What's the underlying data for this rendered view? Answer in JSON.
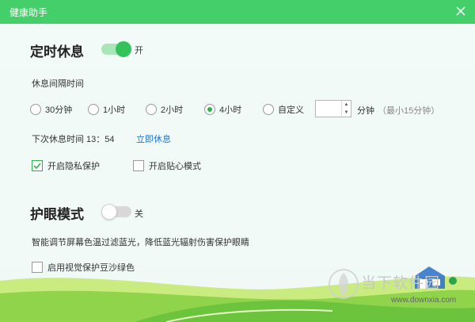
{
  "window": {
    "title": "健康助手"
  },
  "rest": {
    "title": "定时休息",
    "toggle_state": "开",
    "interval_label": "休息间隔时间",
    "options": [
      "30分钟",
      "1小时",
      "2小时",
      "4小时",
      "自定义"
    ],
    "selected_option": "4小时",
    "custom_value": "",
    "custom_unit": "分钟",
    "custom_hint": "（最小15分钟）",
    "next_rest_label": "下次休息时间 13：54",
    "rest_now_link": "立即休息",
    "privacy_label": "开启隐私保护",
    "privacy_checked": true,
    "caring_label": "开启贴心模式",
    "caring_checked": false
  },
  "eye": {
    "title": "护眼模式",
    "toggle_state": "关",
    "description": "智能调节屏幕色温过滤蓝光，降低蓝光辐射伤害保护眼睛",
    "bean_green_label": "启用视觉保护豆沙绿色",
    "bean_green_checked": false
  },
  "watermark": {
    "cn": "当下软件园",
    "url": "www.downxia.com"
  },
  "colors": {
    "titlebar": "#45cf6b",
    "accent": "#34c35a",
    "link": "#1a76d2"
  }
}
